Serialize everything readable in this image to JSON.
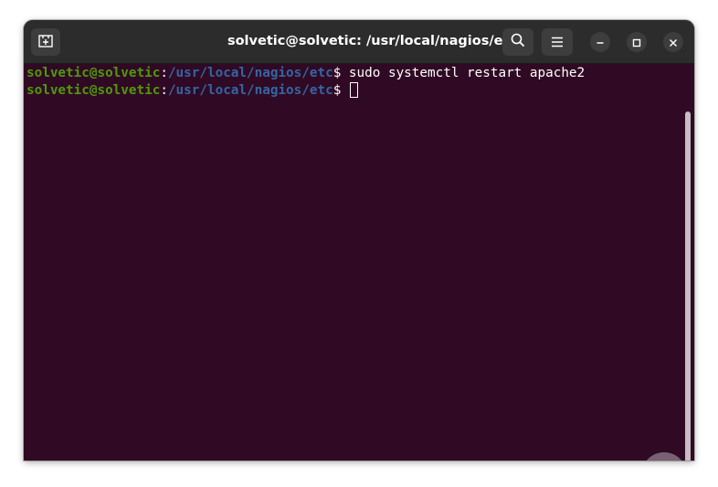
{
  "window": {
    "title": "solvetic@solvetic: /usr/local/nagios/etc"
  },
  "titlebar": {
    "new_tab_icon": "new-tab-icon",
    "search_icon": "search-icon",
    "menu_icon": "hamburger-menu-icon",
    "minimize_icon": "minimize-icon",
    "maximize_icon": "maximize-icon",
    "close_icon": "close-icon"
  },
  "terminal": {
    "lines": [
      {
        "user_host": "solvetic@solvetic",
        "separator": ":",
        "path": "/usr/local/nagios/etc",
        "prompt_symbol": "$ ",
        "command": "sudo systemctl restart apache2"
      },
      {
        "user_host": "solvetic@solvetic",
        "separator": ":",
        "path": "/usr/local/nagios/etc",
        "prompt_symbol": "$ ",
        "command": ""
      }
    ]
  },
  "colors": {
    "background": "#300a24",
    "titlebar": "#2c2c2c",
    "user_host": "#4e9a06",
    "path": "#3465a4",
    "text": "#ffffff"
  },
  "watermark": {
    "icon": "solvetic-logo-icon"
  }
}
